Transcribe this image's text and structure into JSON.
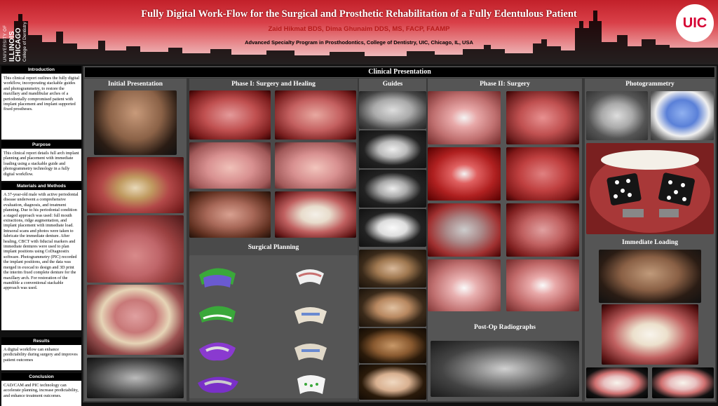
{
  "header": {
    "university_line1": "UNIVERSITY OF",
    "university_line2": "ILLINOIS CHICAGO",
    "university_line3": "College of Dentistry",
    "logo_text": "UIC",
    "title": "Fully Digital Work-Flow for the Surgical and Prosthetic Rehabilitation of a Fully Edentulous Patient",
    "authors": "Zaid Hikmat BDS, Dima Ghunaim DDS, MS, FACP, FAAMP",
    "affiliation": "Advanced Specialty Program in Prosthodontics, College of Dentistry, UIC, Chicago, IL, USA"
  },
  "sidebar": {
    "introduction": {
      "heading": "Introduction",
      "body": "This clinical report outlines the fully digital workflow, incorporating stackable guides and photogrammetry, to restore the maxillary and mandibular arches of a periodontally compromised patient with implant placement and implant supported fixed prostheses."
    },
    "purpose": {
      "heading": "Purpose",
      "body": "This clinical report details full arch implant planning and placement with immediate loading using a stackable guide and photogrammetry technology in a fully digital workflow."
    },
    "materials": {
      "heading": "Materials and Methods",
      "body": "A 37-year-old male with active periodontal disease underwent a comprehensive evaluation, diagnosis, and treatment planning. Due to his periodontal condition a staged approach was used: full mouth extractions, ridge augmentation, and implant placement with immediate load. Intraoral scans and photos were taken to fabricate the immediate denture. After healing, CBCT with fiducial markers and immediate dentures were used to plan implant positions using CoDiagnostix software. Photogrammetry (PIC) recorded the implant positions, and the data was merged in exocad to design and 3D print the interim fixed complete denture for the maxillary arch. For restoration of the mandible a conventional stackable approach was used."
    },
    "results": {
      "heading": "Results",
      "body": "A digital workflow can enhance predictability during surgery and improves patient outcomes"
    },
    "conclusion": {
      "heading": "Conclusion",
      "body": "CAD/CAM and PIC technology can accelerate planning, increase predictability, and enhance treatment outcomes."
    }
  },
  "main": {
    "heading": "Clinical Presentation",
    "columns": {
      "initial": "Initial Presentation",
      "phase1": "Phase I: Surgery and Healing",
      "planning": "Surgical Planning",
      "guides": "Guides",
      "phase2": "Phase II: Surgery",
      "radiographs": "Post-Op Radiographs",
      "photogrammetry": "Photogrammetry",
      "loading": "Immediate Loading"
    }
  },
  "colors": {
    "header_red": "#c2202a",
    "author_red": "#b71c1c",
    "logo_red": "#d50032",
    "panel_gray": "#555555",
    "background_dark": "#3a3a3a"
  }
}
